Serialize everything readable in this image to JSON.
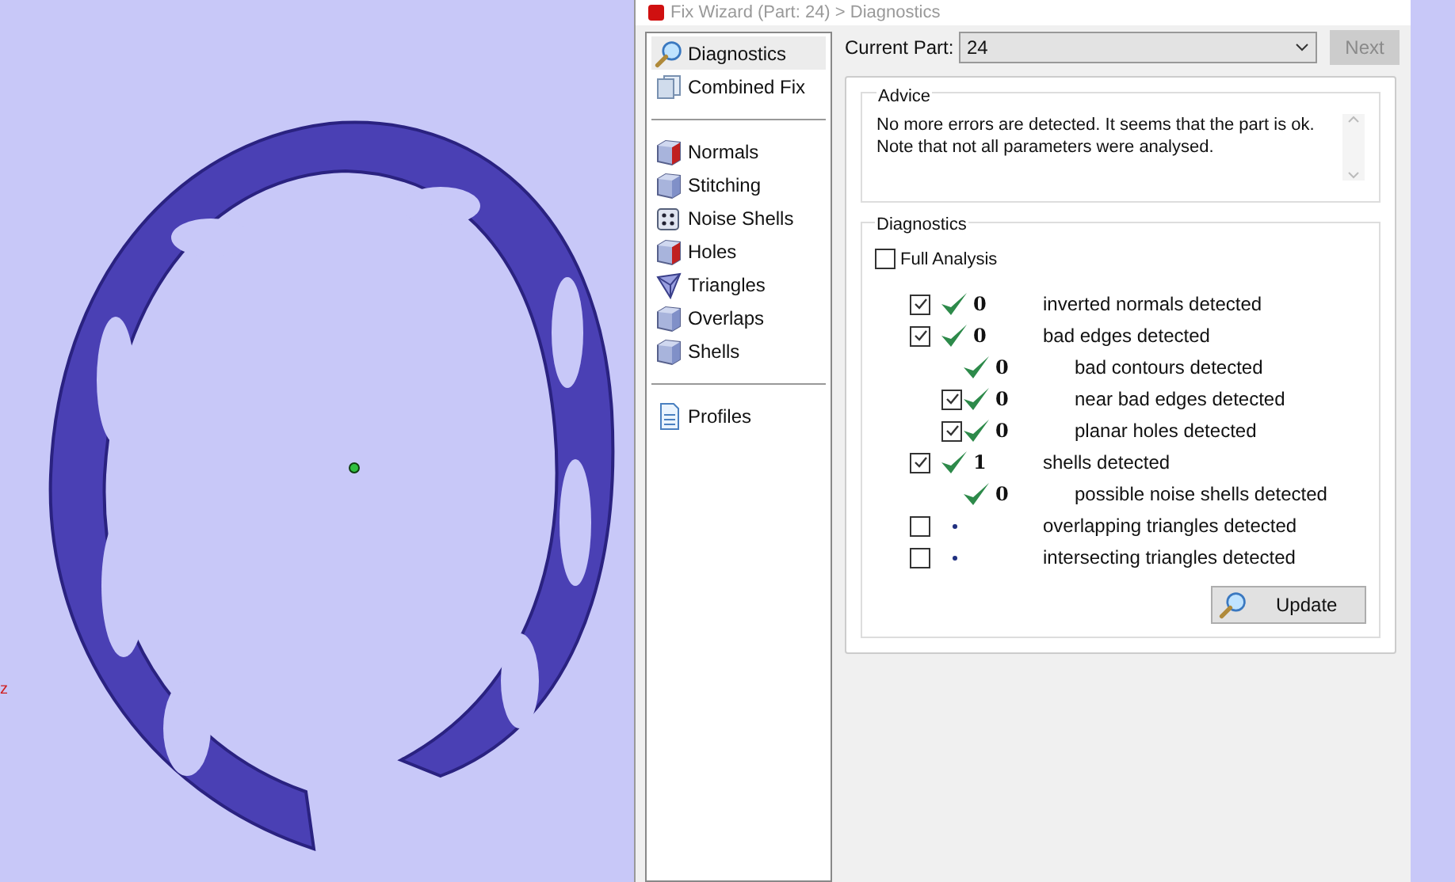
{
  "viewport": {
    "axis_label": "z"
  },
  "window": {
    "title": "Fix Wizard (Part: 24) > Diagnostics"
  },
  "sidebar": {
    "groups": [
      [
        {
          "label": "Diagnostics",
          "kind": "magnifier",
          "selected": true
        },
        {
          "label": "Combined Fix",
          "kind": "pages",
          "selected": false
        }
      ],
      [
        {
          "label": "Normals",
          "kind": "redcube",
          "selected": false
        },
        {
          "label": "Stitching",
          "kind": "cube",
          "selected": false
        },
        {
          "label": "Noise Shells",
          "kind": "dice",
          "selected": false
        },
        {
          "label": "Holes",
          "kind": "redcube",
          "selected": false
        },
        {
          "label": "Triangles",
          "kind": "triangles",
          "selected": false
        },
        {
          "label": "Overlaps",
          "kind": "cube",
          "selected": false
        },
        {
          "label": "Shells",
          "kind": "cube",
          "selected": false
        }
      ],
      [
        {
          "label": "Profiles",
          "kind": "document",
          "selected": false
        }
      ]
    ]
  },
  "current_part": {
    "label": "Current Part:",
    "value": "24"
  },
  "next_button": {
    "label": "Next",
    "disabled": true
  },
  "advice": {
    "title": "Advice",
    "text": "No more errors are detected. It seems that the part is ok.\nNote that not all parameters were analysed."
  },
  "diagnostics": {
    "title": "Diagnostics",
    "full_analysis": {
      "label": "Full Analysis",
      "checked": false
    },
    "rows": [
      {
        "kind": "checkbox",
        "checked": true,
        "analysed": true,
        "count": "0",
        "label": "inverted normals detected"
      },
      {
        "kind": "checkbox",
        "checked": true,
        "analysed": true,
        "count": "0",
        "label": "bad edges detected",
        "children": [
          {
            "kind": "plain",
            "analysed": true,
            "count": "0",
            "label": "bad contours detected"
          },
          {
            "kind": "checkbox",
            "checked": true,
            "analysed": true,
            "count": "0",
            "label": "near bad edges detected"
          },
          {
            "kind": "checkbox",
            "checked": true,
            "analysed": true,
            "count": "0",
            "label": "planar holes detected"
          }
        ]
      },
      {
        "kind": "checkbox",
        "checked": true,
        "analysed": true,
        "count": "1",
        "label": "shells detected",
        "children": [
          {
            "kind": "plain",
            "analysed": true,
            "count": "0",
            "label": "possible noise shells detected"
          }
        ]
      },
      {
        "kind": "checkbox",
        "checked": false,
        "analysed": false,
        "label": "overlapping triangles detected"
      },
      {
        "kind": "checkbox",
        "checked": false,
        "analysed": false,
        "label": "intersecting triangles detected"
      }
    ],
    "update_button": {
      "label": "Update"
    }
  }
}
